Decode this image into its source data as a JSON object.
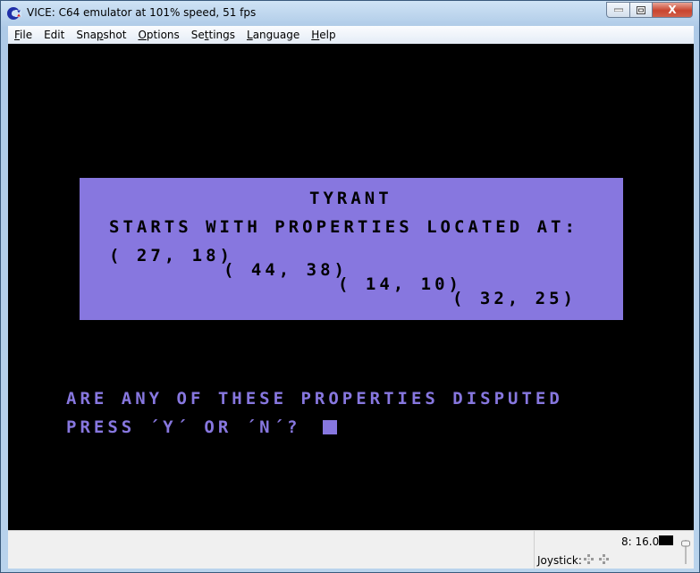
{
  "window": {
    "title": "VICE: C64 emulator at 101% speed, 51 fps",
    "icon": "commodore-logo-icon",
    "controls": {
      "minimize": "minimize-icon",
      "maximize": "maximize-icon",
      "close": "close-icon",
      "close_glyph": "X"
    }
  },
  "menubar": {
    "items": [
      {
        "label": "File",
        "accel": "F"
      },
      {
        "label": "Edit",
        "accel": ""
      },
      {
        "label": "Snapshot",
        "accel": "p"
      },
      {
        "label": "Options",
        "accel": "O"
      },
      {
        "label": "Settings",
        "accel": "t"
      },
      {
        "label": "Language",
        "accel": "L"
      },
      {
        "label": "Help",
        "accel": "H"
      }
    ]
  },
  "screen": {
    "panel": {
      "title": "TYRANT",
      "subtitle": "STARTS WITH PROPERTIES LOCATED AT:",
      "coordinates": [
        "( 27, 18)",
        "( 44, 38)",
        "( 14, 10)",
        "( 32, 25)"
      ]
    },
    "prompt_line1": "ARE ANY OF THESE PROPERTIES DISPUTED",
    "prompt_line2": "PRESS ´Y´ OR ´N´? ",
    "colors": {
      "screen_bg": "#000000",
      "panel_bg": "#8777df",
      "text_light": "#8777df",
      "text_dark": "#000000"
    }
  },
  "statusbar": {
    "joystick_label": "Joystick:",
    "speed_readout": "8: 16.0"
  }
}
